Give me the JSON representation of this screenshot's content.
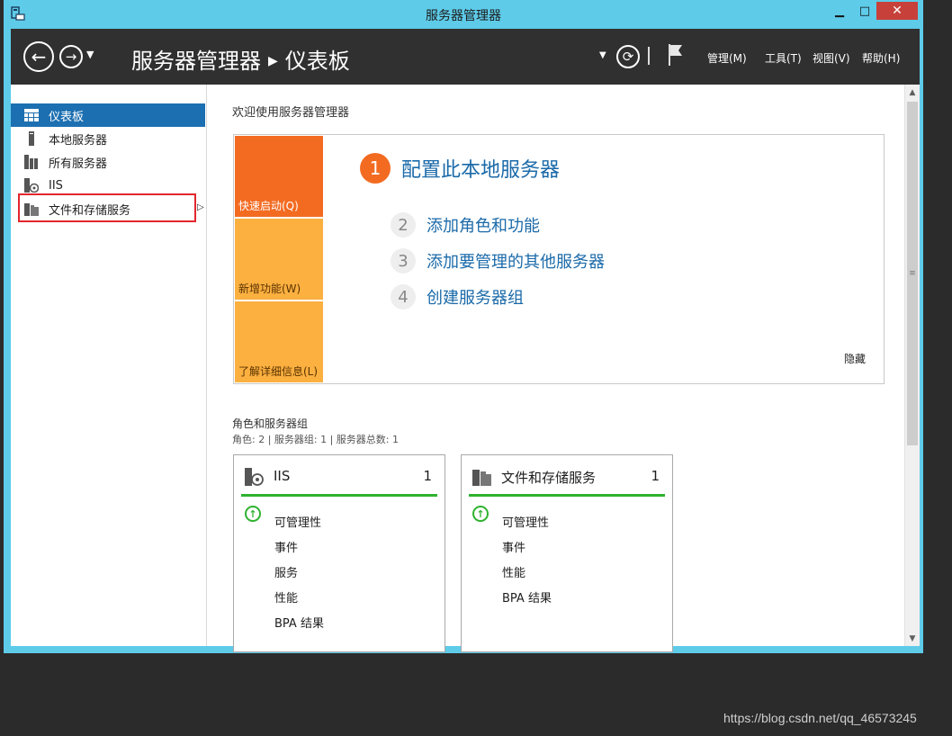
{
  "window": {
    "title": "服务器管理器",
    "minimize": "▁",
    "maximize": "□",
    "close": "✕"
  },
  "toolbar": {
    "breadcrumb_root": "服务器管理器",
    "breadcrumb_sep": "▶",
    "breadcrumb_current": "仪表板",
    "menus": {
      "manage": "管理(M)",
      "tools": "工具(T)",
      "view": "视图(V)",
      "help": "帮助(H)"
    }
  },
  "sidebar": {
    "items": [
      {
        "label": "仪表板",
        "icon": "dashboard-icon",
        "active": true
      },
      {
        "label": "本地服务器",
        "icon": "server-icon"
      },
      {
        "label": "所有服务器",
        "icon": "servers-icon"
      },
      {
        "label": "IIS",
        "icon": "iis-icon"
      },
      {
        "label": "文件和存储服务",
        "icon": "file-storage-icon"
      }
    ]
  },
  "welcome": {
    "title": "欢迎使用服务器管理器",
    "tiles": {
      "quick_start": "快速启动(Q)",
      "whats_new": "新增功能(W)",
      "learn_more": "了解详细信息(L)"
    },
    "steps": [
      {
        "num": "1",
        "label": "配置此本地服务器"
      },
      {
        "num": "2",
        "label": "添加角色和功能"
      },
      {
        "num": "3",
        "label": "添加要管理的其他服务器"
      },
      {
        "num": "4",
        "label": "创建服务器组"
      }
    ],
    "hide": "隐藏"
  },
  "groups": {
    "title": "角色和服务器组",
    "subtitle": "角色: 2 | 服务器组: 1 | 服务器总数: 1",
    "cards": [
      {
        "title": "IIS",
        "count": "1",
        "rows": [
          "可管理性",
          "事件",
          "服务",
          "性能",
          "BPA 结果"
        ]
      },
      {
        "title": "文件和存储服务",
        "count": "1",
        "rows": [
          "可管理性",
          "事件",
          "性能",
          "BPA 结果"
        ]
      }
    ]
  },
  "watermark": "https://blog.csdn.net/qq_46573245",
  "colors": {
    "titlebar": "#5ecbe9",
    "toolbar": "#303030",
    "active_nav": "#1c6fb1",
    "tile_orange": "#f36b21",
    "tile_amber": "#fbb040",
    "link_blue": "#1b6aa9",
    "status_green": "#2fb22f",
    "highlight_red": "#e2262e"
  }
}
